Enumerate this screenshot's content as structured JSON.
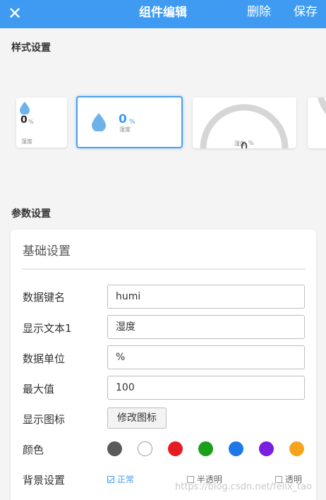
{
  "header": {
    "close_icon": "close-icon",
    "title": "组件编辑",
    "delete_label": "删除",
    "save_label": "保存",
    "bg_color": "#3f9bf2"
  },
  "style_section": {
    "title": "样式设置",
    "cards": [
      {
        "value": "0",
        "unit": "%",
        "label": "湿度",
        "icon": "water-drop-icon"
      },
      {
        "value": "0",
        "unit": "%",
        "label": "湿度",
        "icon": "water-drop-icon"
      },
      {
        "value": "0",
        "unit": "%",
        "label": "湿度",
        "icon": "gauge-arc"
      }
    ]
  },
  "params_section": {
    "title": "参数设置",
    "panel_title": "基础设置",
    "fields": [
      {
        "label": "数据键名",
        "value": "humi"
      },
      {
        "label": "显示文本1",
        "value": "湿度"
      },
      {
        "label": "数据单位",
        "value": "%"
      },
      {
        "label": "最大值",
        "value": "100"
      }
    ],
    "icon_row": {
      "label": "显示图标",
      "button": "修改图标"
    },
    "color_row": {
      "label": "颜色",
      "colors": [
        "#5a5a5a",
        "#ffffff",
        "#e51c23",
        "#1aa01a",
        "#1e78e8",
        "#7a1ee0",
        "#f5a41c"
      ]
    },
    "bg_row": {
      "label": "背景设置",
      "options": [
        "正常",
        "半透明",
        "透明"
      ],
      "selected": "正常"
    }
  },
  "watermark": "https://blog.csdn.net/felix_tao"
}
